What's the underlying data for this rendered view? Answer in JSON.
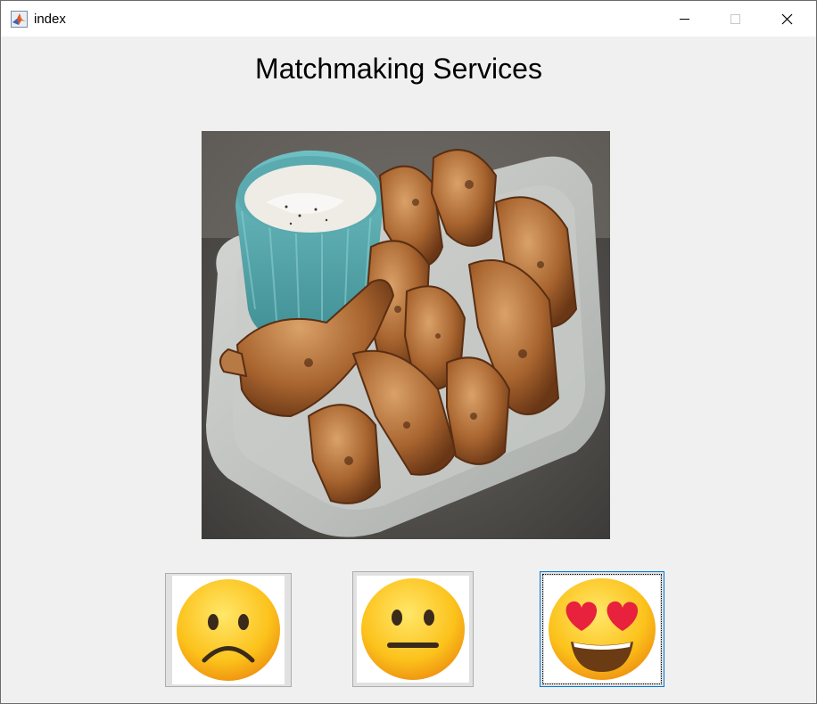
{
  "window": {
    "title": "index",
    "controls": {
      "minimize_icon": "minimize-icon",
      "maximize_icon": "maximize-icon",
      "close_icon": "close-icon"
    }
  },
  "main": {
    "heading": "Matchmaking Services",
    "photo": {
      "subject": "chicken wings with dip"
    },
    "rating_buttons": [
      {
        "name": "sad-face-button",
        "icon": "frowning-face-icon"
      },
      {
        "name": "neutral-face-button",
        "icon": "neutral-face-icon"
      },
      {
        "name": "heart-eyes-button",
        "icon": "heart-eyes-face-icon",
        "focused": true
      }
    ]
  },
  "colors": {
    "window_bg": "#f0f0f0",
    "titlebar_bg": "#ffffff",
    "focus_border": "#0078d7"
  }
}
